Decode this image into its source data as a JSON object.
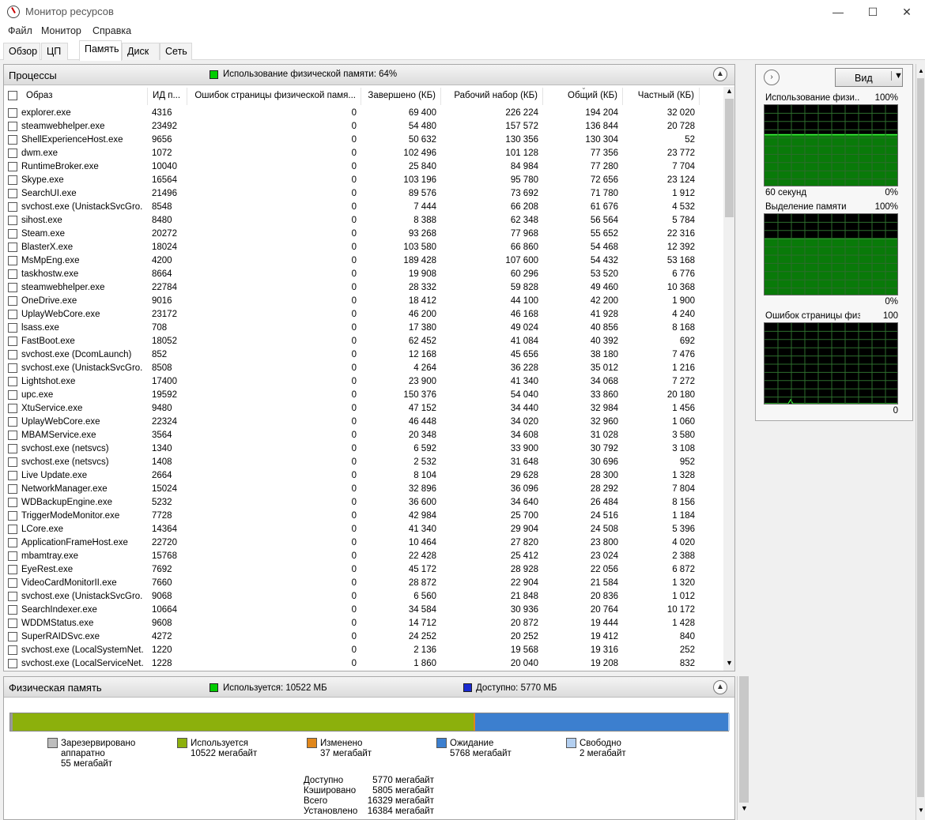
{
  "window": {
    "title": "Монитор ресурсов",
    "minimize": "—",
    "maximize": "☐",
    "close": "✕"
  },
  "menu": [
    "Файл",
    "Монитор",
    "Справка"
  ],
  "tabs": [
    "Обзор",
    "ЦП",
    "Память",
    "Диск",
    "Сеть"
  ],
  "processes": {
    "title": "Процессы",
    "usage_label": "Использование физической памяти: 64%",
    "usage_color": "#00cc00",
    "columns": [
      "Образ",
      "ИД п...",
      "Ошибок страницы физической памя...",
      "Завершено (КБ)",
      "Рабочий набор (КБ)",
      "Общий (КБ)",
      "Частный (КБ)"
    ],
    "rows": [
      [
        "explorer.exe",
        "4316",
        "0",
        "69 400",
        "226 224",
        "194 204",
        "32 020"
      ],
      [
        "steamwebhelper.exe",
        "23492",
        "0",
        "54 480",
        "157 572",
        "136 844",
        "20 728"
      ],
      [
        "ShellExperienceHost.exe",
        "9656",
        "0",
        "50 632",
        "130 356",
        "130 304",
        "52"
      ],
      [
        "dwm.exe",
        "1072",
        "0",
        "102 496",
        "101 128",
        "77 356",
        "23 772"
      ],
      [
        "RuntimeBroker.exe",
        "10040",
        "0",
        "25 840",
        "84 984",
        "77 280",
        "7 704"
      ],
      [
        "Skype.exe",
        "16564",
        "0",
        "103 196",
        "95 780",
        "72 656",
        "23 124"
      ],
      [
        "SearchUI.exe",
        "21496",
        "0",
        "89 576",
        "73 692",
        "71 780",
        "1 912"
      ],
      [
        "svchost.exe (UnistackSvcGro...",
        "8548",
        "0",
        "7 444",
        "66 208",
        "61 676",
        "4 532"
      ],
      [
        "sihost.exe",
        "8480",
        "0",
        "8 388",
        "62 348",
        "56 564",
        "5 784"
      ],
      [
        "Steam.exe",
        "20272",
        "0",
        "93 268",
        "77 968",
        "55 652",
        "22 316"
      ],
      [
        "BlasterX.exe",
        "18024",
        "0",
        "103 580",
        "66 860",
        "54 468",
        "12 392"
      ],
      [
        "MsMpEng.exe",
        "4200",
        "0",
        "189 428",
        "107 600",
        "54 432",
        "53 168"
      ],
      [
        "taskhostw.exe",
        "8664",
        "0",
        "19 908",
        "60 296",
        "53 520",
        "6 776"
      ],
      [
        "steamwebhelper.exe",
        "22784",
        "0",
        "28 332",
        "59 828",
        "49 460",
        "10 368"
      ],
      [
        "OneDrive.exe",
        "9016",
        "0",
        "18 412",
        "44 100",
        "42 200",
        "1 900"
      ],
      [
        "UplayWebCore.exe",
        "23172",
        "0",
        "46 200",
        "46 168",
        "41 928",
        "4 240"
      ],
      [
        "lsass.exe",
        "708",
        "0",
        "17 380",
        "49 024",
        "40 856",
        "8 168"
      ],
      [
        "FastBoot.exe",
        "18052",
        "0",
        "62 452",
        "41 084",
        "40 392",
        "692"
      ],
      [
        "svchost.exe (DcomLaunch)",
        "852",
        "0",
        "12 168",
        "45 656",
        "38 180",
        "7 476"
      ],
      [
        "svchost.exe (UnistackSvcGro...",
        "8508",
        "0",
        "4 264",
        "36 228",
        "35 012",
        "1 216"
      ],
      [
        "Lightshot.exe",
        "17400",
        "0",
        "23 900",
        "41 340",
        "34 068",
        "7 272"
      ],
      [
        "upc.exe",
        "19592",
        "0",
        "150 376",
        "54 040",
        "33 860",
        "20 180"
      ],
      [
        "XtuService.exe",
        "9480",
        "0",
        "47 152",
        "34 440",
        "32 984",
        "1 456"
      ],
      [
        "UplayWebCore.exe",
        "22324",
        "0",
        "46 448",
        "34 020",
        "32 960",
        "1 060"
      ],
      [
        "MBAMService.exe",
        "3564",
        "0",
        "20 348",
        "34 608",
        "31 028",
        "3 580"
      ],
      [
        "svchost.exe (netsvcs)",
        "1340",
        "0",
        "6 592",
        "33 900",
        "30 792",
        "3 108"
      ],
      [
        "svchost.exe (netsvcs)",
        "1408",
        "0",
        "2 532",
        "31 648",
        "30 696",
        "952"
      ],
      [
        "Live Update.exe",
        "2664",
        "0",
        "8 104",
        "29 628",
        "28 300",
        "1 328"
      ],
      [
        "NetworkManager.exe",
        "15024",
        "0",
        "32 896",
        "36 096",
        "28 292",
        "7 804"
      ],
      [
        "WDBackupEngine.exe",
        "5232",
        "0",
        "36 600",
        "34 640",
        "26 484",
        "8 156"
      ],
      [
        "TriggerModeMonitor.exe",
        "7728",
        "0",
        "42 984",
        "25 700",
        "24 516",
        "1 184"
      ],
      [
        "LCore.exe",
        "14364",
        "0",
        "41 340",
        "29 904",
        "24 508",
        "5 396"
      ],
      [
        "ApplicationFrameHost.exe",
        "22720",
        "0",
        "10 464",
        "27 820",
        "23 800",
        "4 020"
      ],
      [
        "mbamtray.exe",
        "15768",
        "0",
        "22 428",
        "25 412",
        "23 024",
        "2 388"
      ],
      [
        "EyeRest.exe",
        "7692",
        "0",
        "45 172",
        "28 928",
        "22 056",
        "6 872"
      ],
      [
        "VideoCardMonitorII.exe",
        "7660",
        "0",
        "28 872",
        "22 904",
        "21 584",
        "1 320"
      ],
      [
        "svchost.exe (UnistackSvcGro...",
        "9068",
        "0",
        "6 560",
        "21 848",
        "20 836",
        "1 012"
      ],
      [
        "SearchIndexer.exe",
        "10664",
        "0",
        "34 584",
        "30 936",
        "20 764",
        "10 172"
      ],
      [
        "WDDMStatus.exe",
        "9608",
        "0",
        "14 712",
        "20 872",
        "19 444",
        "1 428"
      ],
      [
        "SuperRAIDSvc.exe",
        "4272",
        "0",
        "24 252",
        "20 252",
        "19 412",
        "840"
      ],
      [
        "svchost.exe (LocalSystemNet...",
        "1220",
        "0",
        "2 136",
        "19 568",
        "19 316",
        "252"
      ],
      [
        "svchost.exe (LocalServiceNet...",
        "1228",
        "0",
        "1 860",
        "20 040",
        "19 208",
        "832"
      ]
    ]
  },
  "physical": {
    "title": "Физическая память",
    "used_label": "Используется: 10522 МБ",
    "available_label": "Доступно: 5770 МБ",
    "bar": {
      "reserved_mb": 55,
      "used_mb": 10522,
      "modified_mb": 37,
      "standby_mb": 5768,
      "free_mb": 2,
      "colors": {
        "reserved": "#9a9a9a",
        "used": "#8cb00c",
        "modified": "#e0861a",
        "standby": "#3c7fcf",
        "free": "#b3cff0"
      }
    },
    "legend": [
      {
        "name": "Зарезервировано",
        "line2": "аппаратно",
        "value": "55 мегабайт",
        "color": "#bdbdbd"
      },
      {
        "name": "Используется",
        "value": "10522 мегабайт",
        "color": "#8cb00c"
      },
      {
        "name": "Изменено",
        "value": "37 мегабайт",
        "color": "#e0861a"
      },
      {
        "name": "Ожидание",
        "value": "5768 мегабайт",
        "color": "#3c7fcf"
      },
      {
        "name": "Свободно",
        "value": "2 мегабайт",
        "color": "#b3cff0"
      }
    ],
    "summary": [
      {
        "label": "Доступно",
        "value": "5770 мегабайт"
      },
      {
        "label": "Кэшировано",
        "value": "5805 мегабайт"
      },
      {
        "label": "Всего",
        "value": "16329 мегабайт"
      },
      {
        "label": "Установлено",
        "value": "16384 мегабайт"
      }
    ]
  },
  "graphs": {
    "view_button": "Вид",
    "panels": [
      {
        "title": "Использование физи...",
        "max": "100%",
        "time": "60 секунд",
        "min": "0%",
        "level": 0.64
      },
      {
        "title": "Выделение памяти",
        "max": "100%",
        "time": "",
        "min": "0%",
        "level": 0.7
      },
      {
        "title": "Ошибок страницы физи...",
        "max": "100",
        "time": "",
        "min": "0",
        "level": 0
      }
    ]
  }
}
